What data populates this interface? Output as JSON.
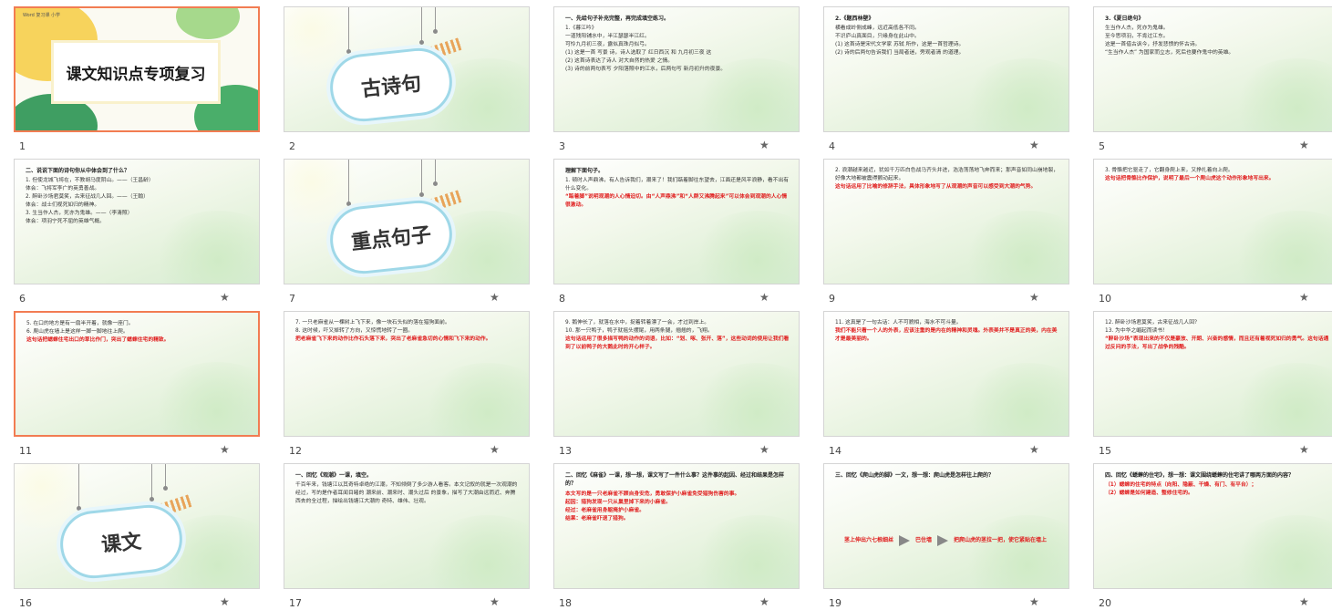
{
  "slides": [
    {
      "number": "1",
      "kind": "title",
      "title": "课文知识点专项复习",
      "header": "Word 复习课 小学",
      "selected": true
    },
    {
      "number": "2",
      "kind": "section",
      "title": "古诗句"
    },
    {
      "number": "3",
      "kind": "text",
      "head": "一、先给句子补充完整，再完成填空练习。",
      "lines": [
        "1.《暮江吟》",
        "一道残阳铺水中，半江瑟瑟半江红。",
        "可怜九月初三夜，露似真珠月似弓。",
        "(1) 这是一首 写景 诗，诗人选取了 红日西沉 和 九月初三夜 这",
        "(2) 这首诗表达了诗人 对大自然的热爱 之情。",
        "(3) 诗的前两句表写 夕阳落照中的江水，后两句写 新月初升的夜景。"
      ],
      "red": ""
    },
    {
      "number": "4",
      "kind": "text",
      "head": "2.《题西林壁》",
      "lines": [
        "横看成岭侧成峰，远近高低各不同。",
        "不识庐山真面目，只缘身在此山中。",
        "(1) 这首诗是宋代文学家 苏轼 所作，这是一首哲理诗。",
        "(2) 诗的后两句告诉我们 当局者迷，旁观者清 的道理。"
      ],
      "red": ""
    },
    {
      "number": "5",
      "kind": "text",
      "head": "3.《夏日绝句》",
      "lines": [
        "生当作人杰，死亦为鬼雄。",
        "至今思项羽，不肯过江东。",
        "这是一首借古讽今，抒发悲愤的怀古诗。",
        "“生当作人杰” 为国家而立志，死后也要作鬼中的英雄。"
      ],
      "red": ""
    },
    {
      "number": "6",
      "kind": "text",
      "head": "二、说说下面的诗句你从中体会到了什么？",
      "lines": [
        "1. 但使龙城飞将在，不教胡马度阴山。——（王昌龄）",
        "体会：飞将军李广的英勇善战。",
        "2. 醉卧沙场君莫笑，古来征战几人回。——（王翰）",
        "体会：战士们视死如归的精神。",
        "3. 生当作人杰，死亦为鬼雄。——（李清照）",
        "体会：项羽宁死不屈的英雄气概。"
      ],
      "red": ""
    },
    {
      "number": "7",
      "kind": "section",
      "title": "重点句子"
    },
    {
      "number": "8",
      "kind": "text",
      "head": "理解下面句子。",
      "lines": [
        "1. 顿时人声鼎沸，有人告诉我们，潮来了！我们踮着脚往东望去，江面还是风平浪静，看不出有什么变化。"
      ],
      "red": "“踮着脚”说明观潮的人心情迫切。由“人声鼎沸”和“人群又沸腾起来”可以体会到观潮的人心情很激动。"
    },
    {
      "number": "9",
      "kind": "text",
      "head": "",
      "lines": [
        "2. 浪潮越来越近，犹如千万匹白色战马齐头并进，浩浩荡荡地飞奔而来；那声音如同山崩地裂，好像大地都被震得颤动起来。"
      ],
      "red": "这句话运用了比喻的修辞手法，具体形象地写了从观潮的声音可以感受到大潮的气势。"
    },
    {
      "number": "10",
      "kind": "text",
      "head": "",
      "lines": [
        "3. 骨骼把它驱走了，它翻身爬上来，又挣扎着向上爬。"
      ],
      "red": "这句话把骨骼比作保护，说明了最后一个爬山虎这个动作形象地写出来。"
    },
    {
      "number": "11",
      "kind": "text",
      "head": "",
      "lines": [
        "5. 在口的地方是有一扇半开着，就像一座门。",
        "6. 爬山虎在墙上是这样一脚一脚地往上爬。"
      ],
      "red": "这句话把蟋蟀住宅出口的草比作门，突出了蟋蟀住宅的精致。",
      "selected": true
    },
    {
      "number": "12",
      "kind": "text",
      "head": "",
      "lines": [
        "7. 一只老麻雀从一棵树上飞下来，像一块石头似的落在猎狗面前。",
        "8. 这时候，吓又掉转了方向，又惊慌地转了一圈。"
      ],
      "red": "把老麻雀飞下来的动作比作石头落下来，突出了老麻雀急切的心情和飞下来的动作。"
    },
    {
      "number": "13",
      "kind": "text",
      "head": "",
      "lines": [
        "9. 鹅伸长了，就落在水中，捉着转着漂了一会，才过到岸上。",
        "10. 那一只鸭子，鸭子就摇头摆尾，用两条腿，翘翘的，飞翔。"
      ],
      "red": "这句话运用了很多描写鸭的动作的词语，比如：“划、啄、张开、落”，这些动词的使用让我们看到了以前鸭子的大鹅此时的开心样子。"
    },
    {
      "number": "14",
      "kind": "text",
      "head": "",
      "lines": [
        "11. 这真是了一句古话：人不可貌相，海水不可斗量。"
      ],
      "red": "我们不能只看一个人的外表，应该注重的是内在的精神和灵魂。外表美并不是真正的美，内在美才是最美丽的。"
    },
    {
      "number": "15",
      "kind": "text",
      "head": "",
      "lines": [
        "12. 醉卧沙场君莫笑，古来征战几人回？",
        "13. 为中华之崛起而读书！"
      ],
      "red": "“醉卧沙场”表现出来的不仅是豪放、开朗、兴奋的感情，而且还有着视死如归的勇气。这句话通过反问的手法，写出了战争的残酷。"
    },
    {
      "number": "16",
      "kind": "section",
      "title": "课文"
    },
    {
      "number": "17",
      "kind": "text",
      "head": "一、回忆《观潮》一课，填空。",
      "lines": [
        "千百年来，钱塘江以其奇特卓绝的江潮，不知倾倒了多少游人看客。本文记叙的就是一次观潮的经过，写的是作者耳闻目睹的 潮来前、潮来时、潮头过后 的景象，描写了大潮由远而近、奔腾西去的全过程，描绘出钱塘江大潮的 奇特、雄伟、壮观。"
      ],
      "red": ""
    },
    {
      "number": "18",
      "kind": "text",
      "head": "二、回忆《麻雀》一课，想一想，课文写了一件什么事？这件事的起因、经过和结果是怎样的？",
      "lines": [],
      "red": "本文写的是一只老麻雀不顾自身安危，勇敢保护小麻雀免受猎狗伤害的事。\n起因：猎狗发现一只从巢里掉下来的小麻雀。\n经过：老麻雀用身躯掩护小麻雀。\n结果：老麻雀吓退了猎狗。"
    },
    {
      "number": "19",
      "kind": "diagram",
      "head": "三、回忆《爬山虎的脚》一文，想一想：爬山虎是怎样往上爬的？",
      "steps": [
        "茎上伸出六七根细丝",
        "巴住墙",
        "把爬山虎的茎拉一把，使它紧贴在墙上"
      ]
    },
    {
      "number": "20",
      "kind": "text",
      "head": "四、回忆《蟋蟀的住宅》，想一想：课文围绕蟋蟀的住宅讲了哪两方面的内容？",
      "lines": [],
      "red": "（1）蟋蟀的住宅的特点（向阳、隐蔽、干燥、有门、有平台）；\n（2）蟋蟀是如何建造、整修住宅的。"
    }
  ],
  "star_glyph": "★"
}
